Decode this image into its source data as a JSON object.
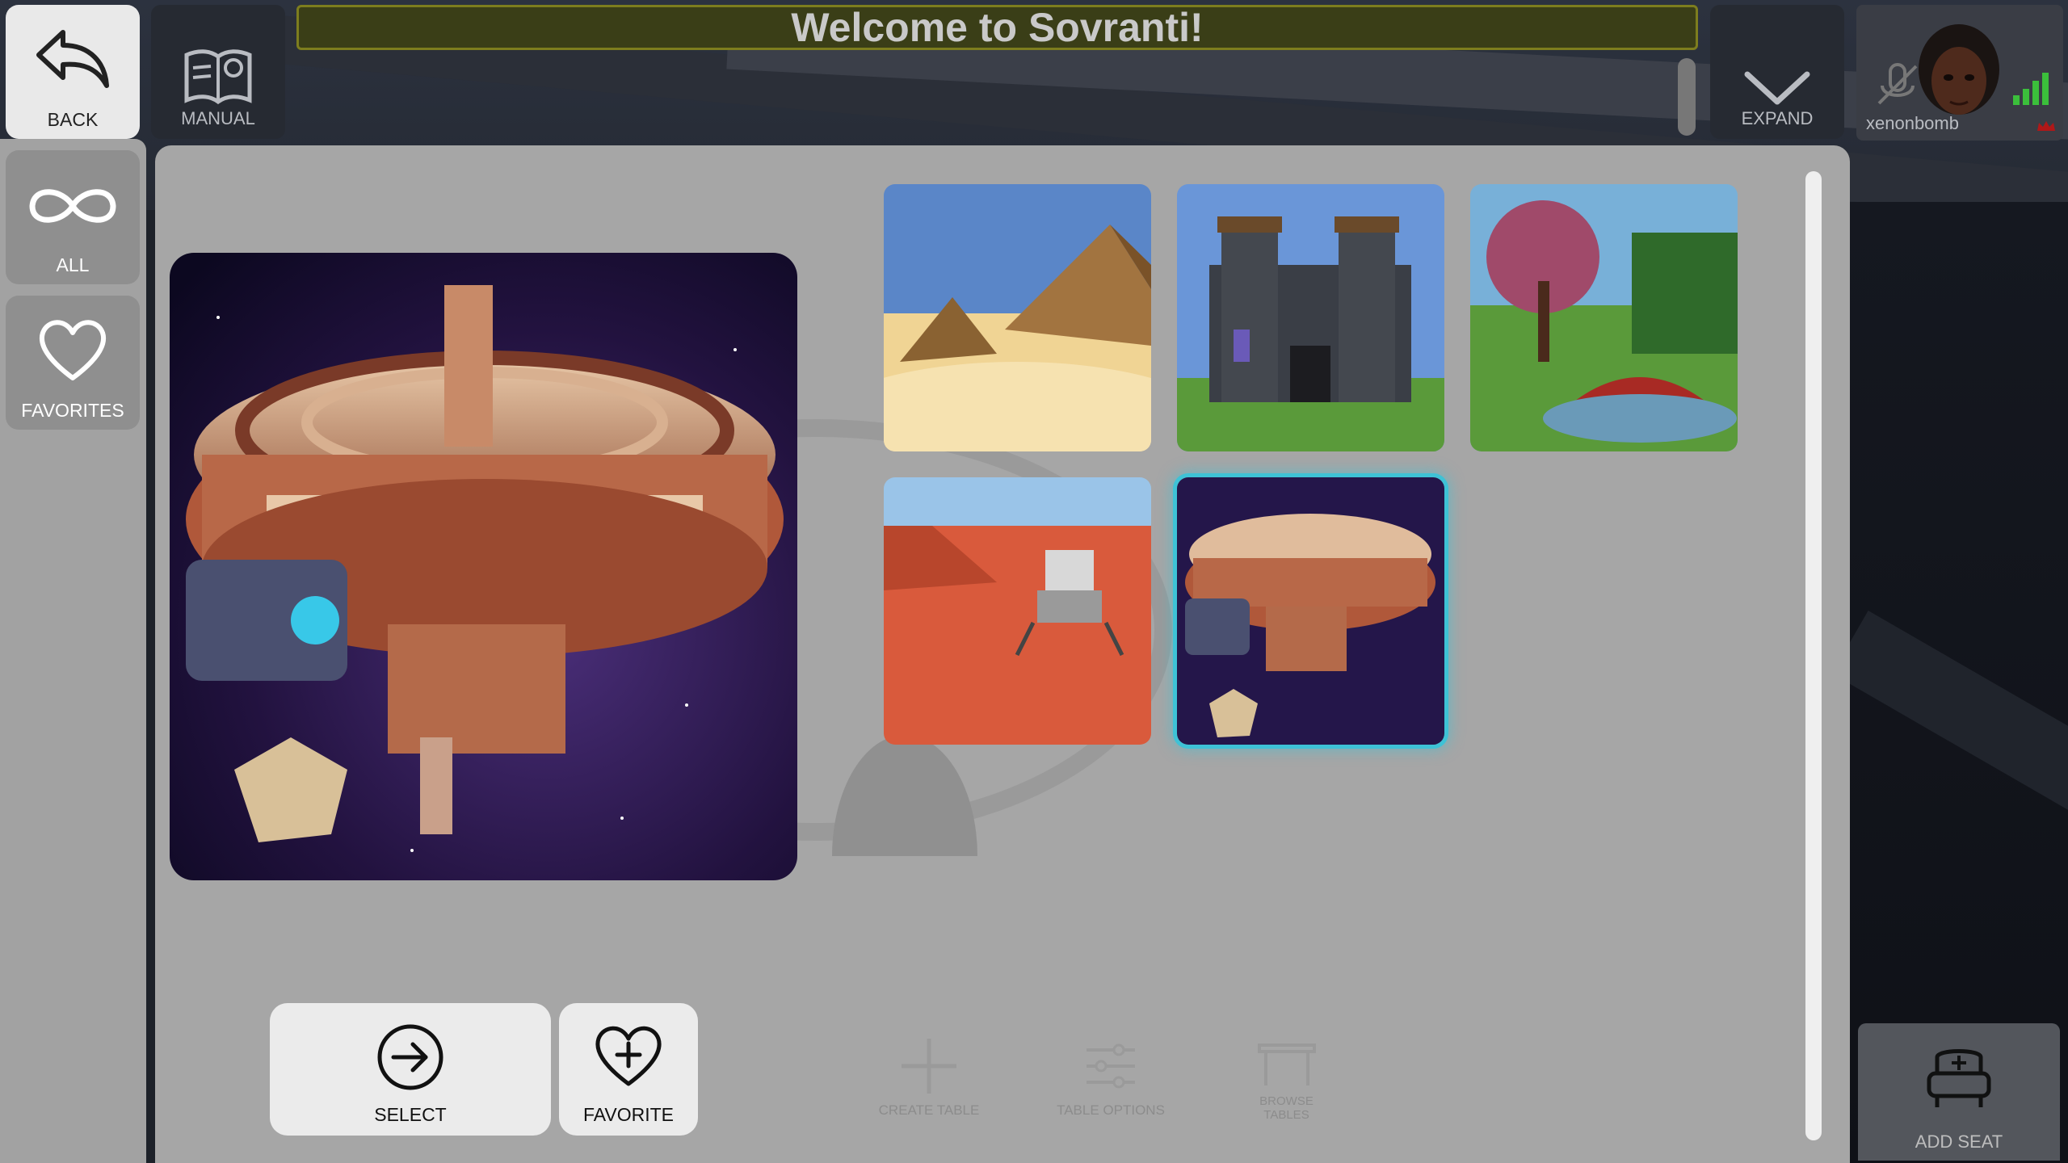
{
  "top_bar": {
    "back_label": "BACK",
    "manual_label": "MANUAL",
    "title": "Welcome to Sovranti!",
    "expand_label": "EXPAND"
  },
  "user": {
    "name": "xenonbomb",
    "mic_icon": "muted-mic-icon",
    "signal_icon": "signal-bars-icon"
  },
  "sidebar": {
    "items": [
      {
        "label": "ALL",
        "icon": "infinity-icon"
      },
      {
        "label": "FAVORITES",
        "icon": "heart-icon"
      }
    ]
  },
  "environments": {
    "preview": "space-station",
    "thumbnails": [
      {
        "name": "pyramids-desert",
        "selected": false
      },
      {
        "name": "castle",
        "selected": false
      },
      {
        "name": "japanese-garden",
        "selected": false
      },
      {
        "name": "mars-lander",
        "selected": false
      },
      {
        "name": "space-station",
        "selected": true
      }
    ]
  },
  "actions": {
    "select_label": "SELECT",
    "favorite_label": "FAVORITE"
  },
  "background_toolbar": {
    "create_table": "CREATE TABLE",
    "table_options": "TABLE OPTIONS",
    "browse_tables": "BROWSE TABLES",
    "add_seat": "ADD SEAT"
  },
  "colors": {
    "accent_selection": "#3ec2d6",
    "title_border": "#7d7d1e",
    "panel": "#a6a6a6"
  }
}
